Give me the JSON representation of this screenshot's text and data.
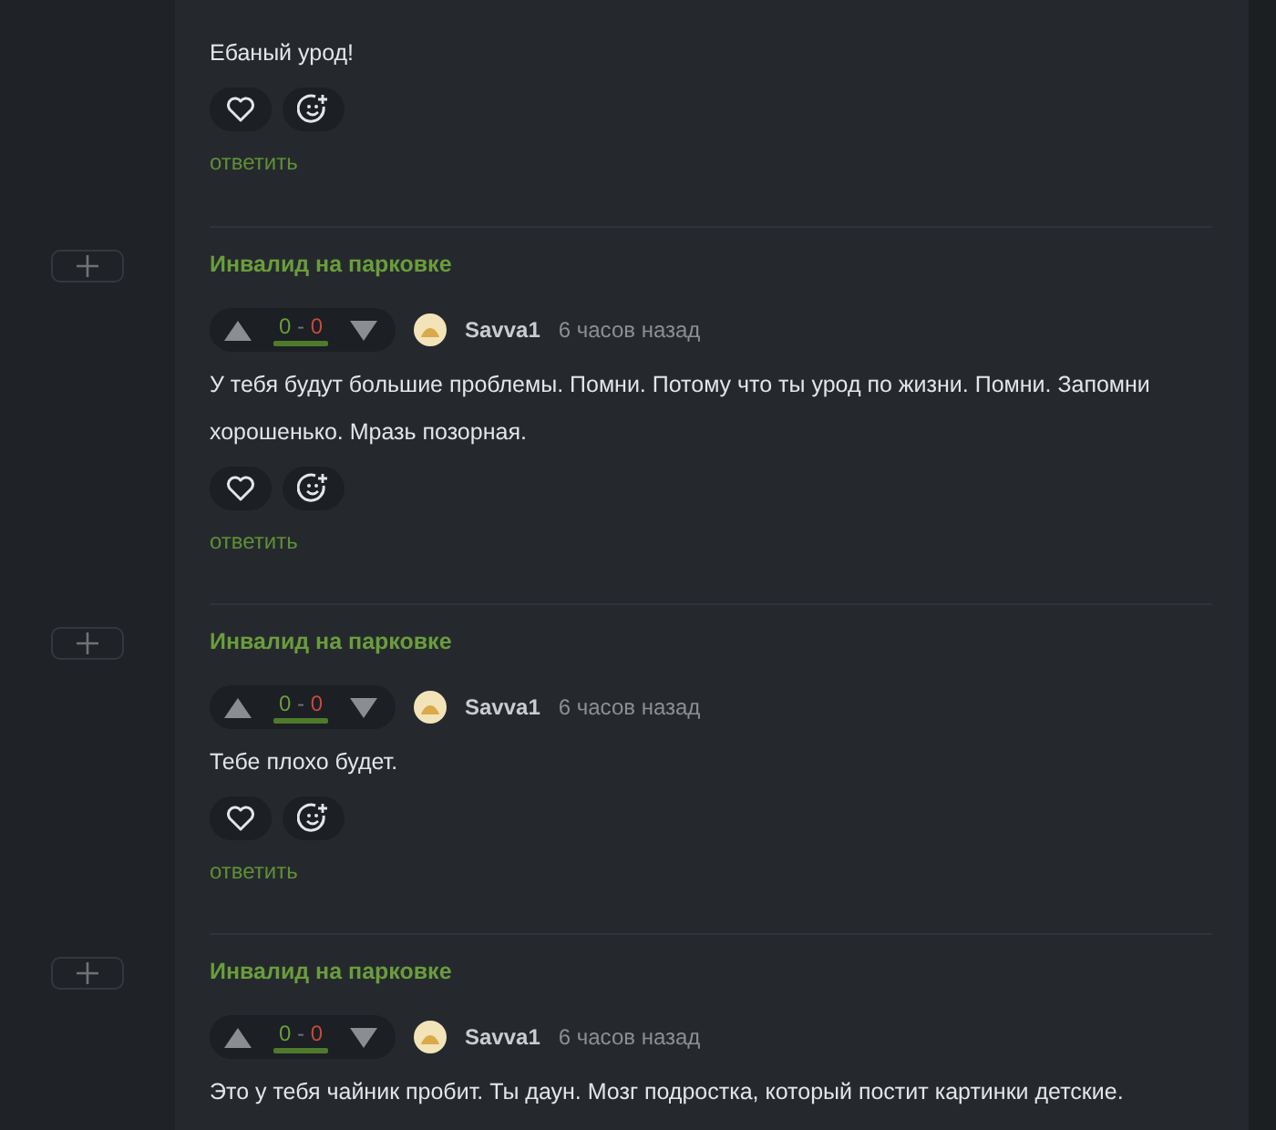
{
  "comments": [
    {
      "body": "Ебаный урод!",
      "reply": "ответить"
    },
    {
      "title": "Инвалид на парковке",
      "votes": {
        "up": "0",
        "sep": "-",
        "down": "0"
      },
      "author": "Savva1",
      "time": "6 часов назад",
      "body": "У тебя будут большие проблемы. Помни. Потому что ты урод по жизни. Помни. Запомни хорошенько. Мразь позорная.",
      "reply": "ответить"
    },
    {
      "title": "Инвалид на парковке",
      "votes": {
        "up": "0",
        "sep": "-",
        "down": "0"
      },
      "author": "Savva1",
      "time": "6 часов назад",
      "body": "Тебе плохо будет.",
      "reply": "ответить"
    },
    {
      "title": "Инвалид на парковке",
      "votes": {
        "up": "0",
        "sep": "-",
        "down": "0"
      },
      "author": "Savva1",
      "time": "6 часов назад",
      "body": "Это у тебя чайник пробит. Ты даун. Мозг подростка, который постит картинки детские."
    }
  ]
}
